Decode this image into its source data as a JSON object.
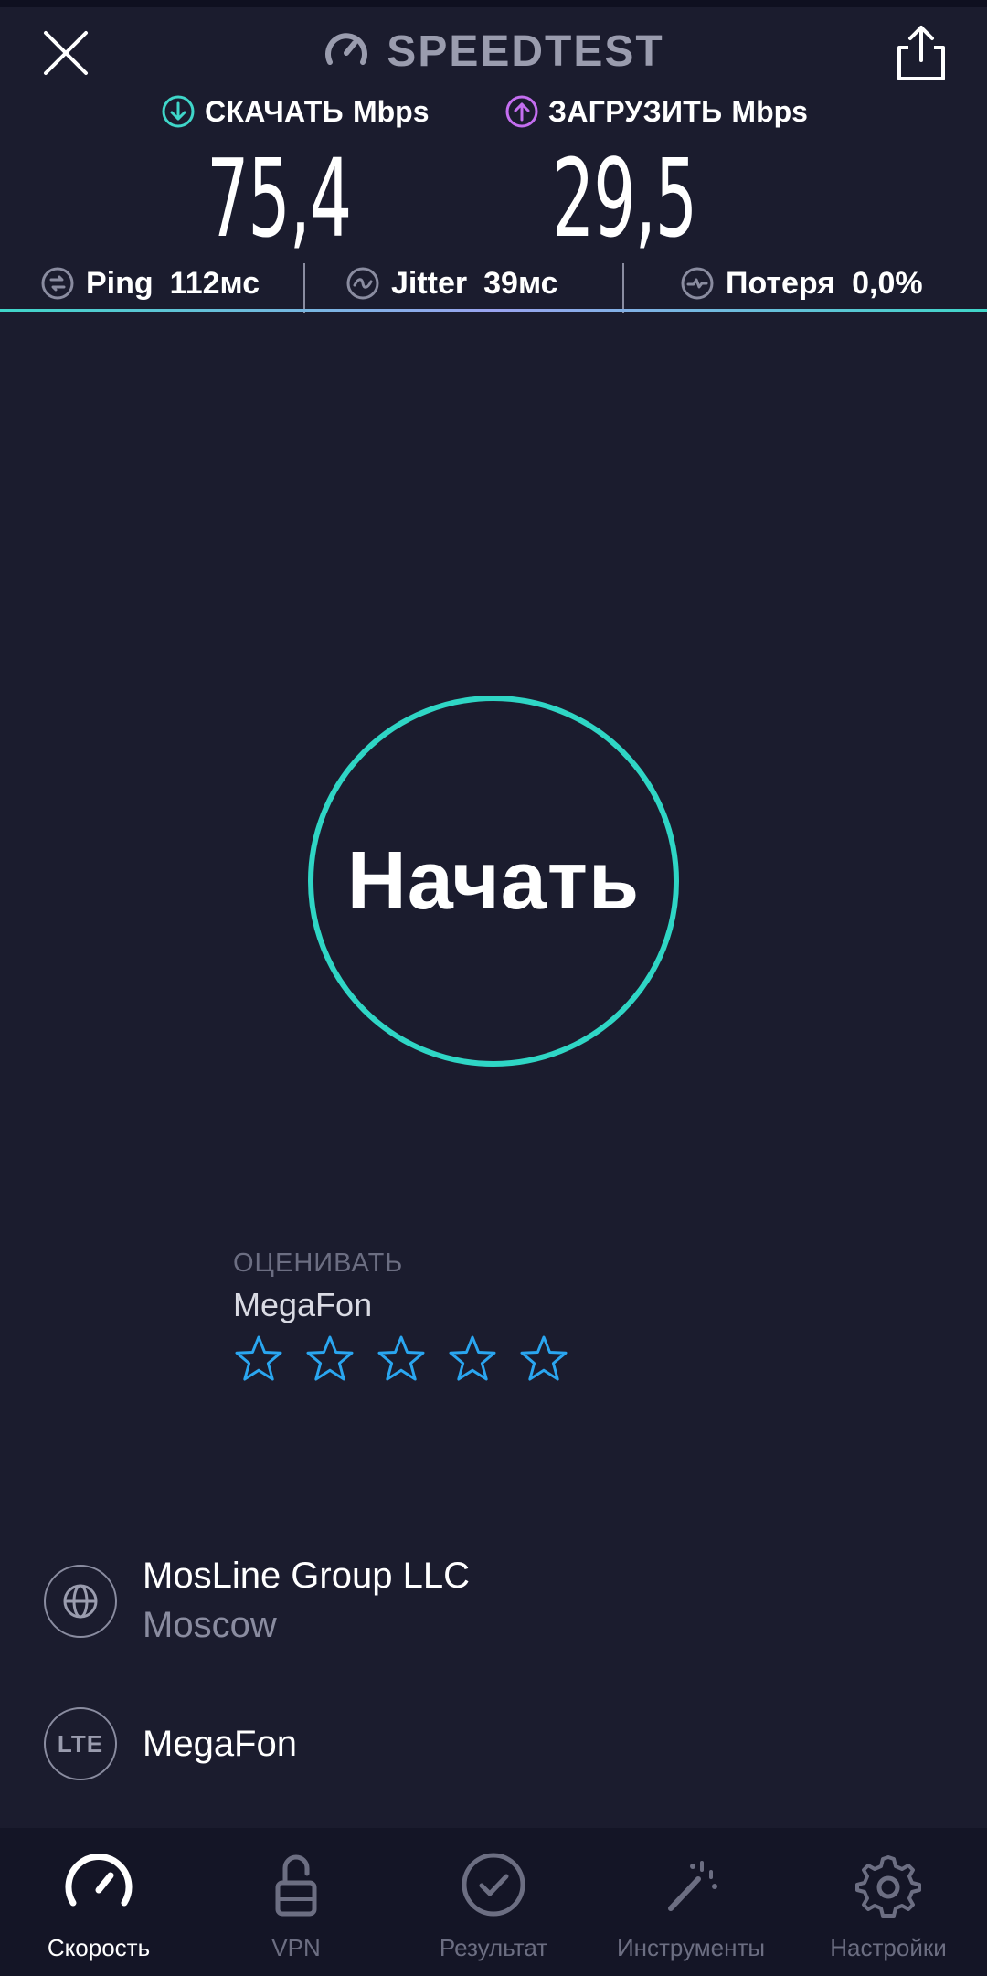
{
  "app": {
    "brand": "SPEEDTEST",
    "accent_color": "#2fd6c5",
    "download_color": "#3fd6c9",
    "upload_color": "#c46ef0",
    "background": "#1b1c2e"
  },
  "header": {
    "close_icon": "close-icon",
    "share_icon": "share-icon",
    "brand_icon": "speedometer-icon"
  },
  "results": {
    "download": {
      "label": "СКАЧАТЬ",
      "unit": "Mbps",
      "value": "75,4",
      "icon": "download-arrow-icon"
    },
    "upload": {
      "label": "ЗАГРУЗИТЬ",
      "unit": "Mbps",
      "value": "29,5",
      "icon": "upload-arrow-icon"
    }
  },
  "metrics": {
    "ping": {
      "label": "Ping",
      "value": "112мс",
      "icon": "ping-icon"
    },
    "jitter": {
      "label": "Jitter",
      "value": "39мс",
      "icon": "jitter-icon"
    },
    "loss": {
      "label": "Потеря",
      "value": "0,0%",
      "icon": "packet-loss-icon"
    }
  },
  "start_button": {
    "label": "Начать"
  },
  "rating": {
    "label": "ОЦЕНИВАТЬ",
    "provider": "MegaFon",
    "stars_total": 5,
    "stars_filled": 0,
    "star_color": "#2aa6f0"
  },
  "server": {
    "name": "MosLine Group LLC",
    "location": "Moscow",
    "icon": "globe-icon"
  },
  "network": {
    "badge": "LTE",
    "provider": "MegaFon",
    "icon": "lte-icon"
  },
  "bottom_nav": {
    "items": [
      {
        "label": "Скорость",
        "icon": "speedometer-icon",
        "active": true
      },
      {
        "label": "VPN",
        "icon": "unlock-icon",
        "active": false
      },
      {
        "label": "Результат",
        "icon": "checkmark-circle-icon",
        "active": false
      },
      {
        "label": "Инструменты",
        "icon": "magic-wand-icon",
        "active": false
      },
      {
        "label": "Настройки",
        "icon": "gear-icon",
        "active": false
      }
    ]
  }
}
